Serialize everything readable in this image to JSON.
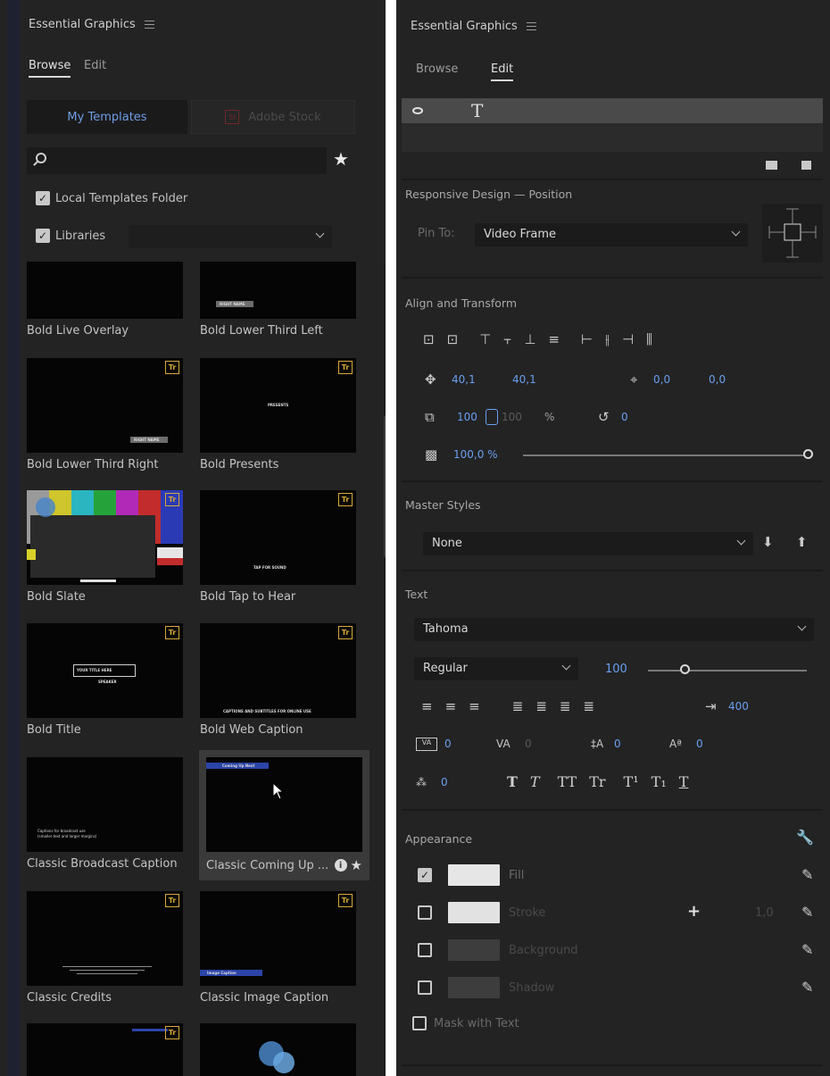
{
  "left": {
    "panel_title": "Essential Graphics",
    "tabs": {
      "browse": "Browse",
      "edit": "Edit"
    },
    "segments": {
      "my_templates": "My Templates",
      "adobe_stock": "Adobe Stock",
      "stock_logo": "St"
    },
    "search": {
      "placeholder": ""
    },
    "local_templates": "Local Templates Folder",
    "libraries": "Libraries",
    "badge_text": "Tr",
    "tiles": [
      {
        "label": "Bold Live Overlay"
      },
      {
        "label": "Bold Lower Third Left",
        "thumb_text": "RIGHT NAME"
      },
      {
        "label": "Bold Lower Third Right",
        "thumb_text": "RIGHT NAME"
      },
      {
        "label": "Bold Presents",
        "thumb_text": "PRESENTS"
      },
      {
        "label": "Bold Slate"
      },
      {
        "label": "Bold Tap to Hear",
        "thumb_text": "TAP FOR SOUND"
      },
      {
        "label": "Bold Title",
        "thumb_text": "YOUR TITLE HERE",
        "thumb_subtext": "SPEAKER"
      },
      {
        "label": "Bold Web Caption",
        "thumb_text": "CAPTIONS AND SUBTITLES FOR ONLINE USE"
      },
      {
        "label": "Classic Broadcast Caption",
        "thumb_text": "Captions for broadcast use",
        "thumb_subtext": "(smaller text and larger margins)"
      },
      {
        "label": "Classic Coming Up ...",
        "thumb_text": "Coming Up Next"
      },
      {
        "label": "Classic Credits"
      },
      {
        "label": "Classic Image Caption",
        "thumb_text": "Image Caption"
      },
      {
        "label": ""
      },
      {
        "label": ""
      }
    ],
    "colors": {
      "accent_blue": "#6f9de6",
      "badge": "#d7a93a"
    }
  },
  "right": {
    "panel_title": "Essential Graphics",
    "tabs": {
      "browse": "Browse",
      "edit": "Edit"
    },
    "responsive": {
      "title": "Responsive Design — Position",
      "pin_label": "Pin To:",
      "pin_value": "Video Frame"
    },
    "align": {
      "title": "Align and Transform",
      "pos_x": "40,1",
      "pos_y": "40,1",
      "anchor_x": "0,0",
      "anchor_y": "0,0",
      "scale": "100",
      "scale_locked": "100",
      "pct": "%",
      "rotation": "0",
      "opacity": "100,0 %"
    },
    "master": {
      "title": "Master Styles",
      "value": "None"
    },
    "text": {
      "title": "Text",
      "font": "Tahoma",
      "style": "Regular",
      "size": "100",
      "tab_width": "400",
      "kerning": "0",
      "tracking": "0",
      "leading": "0",
      "baseline": "0",
      "tsume": "0",
      "style_buttons": [
        "T",
        "T",
        "TT",
        "Tr",
        "T¹",
        "T₁",
        "T"
      ]
    },
    "appearance": {
      "title": "Appearance",
      "fill": "Fill",
      "stroke": "Stroke",
      "stroke_width": "1,0",
      "background": "Background",
      "shadow": "Shadow",
      "mask": "Mask with Text"
    }
  }
}
